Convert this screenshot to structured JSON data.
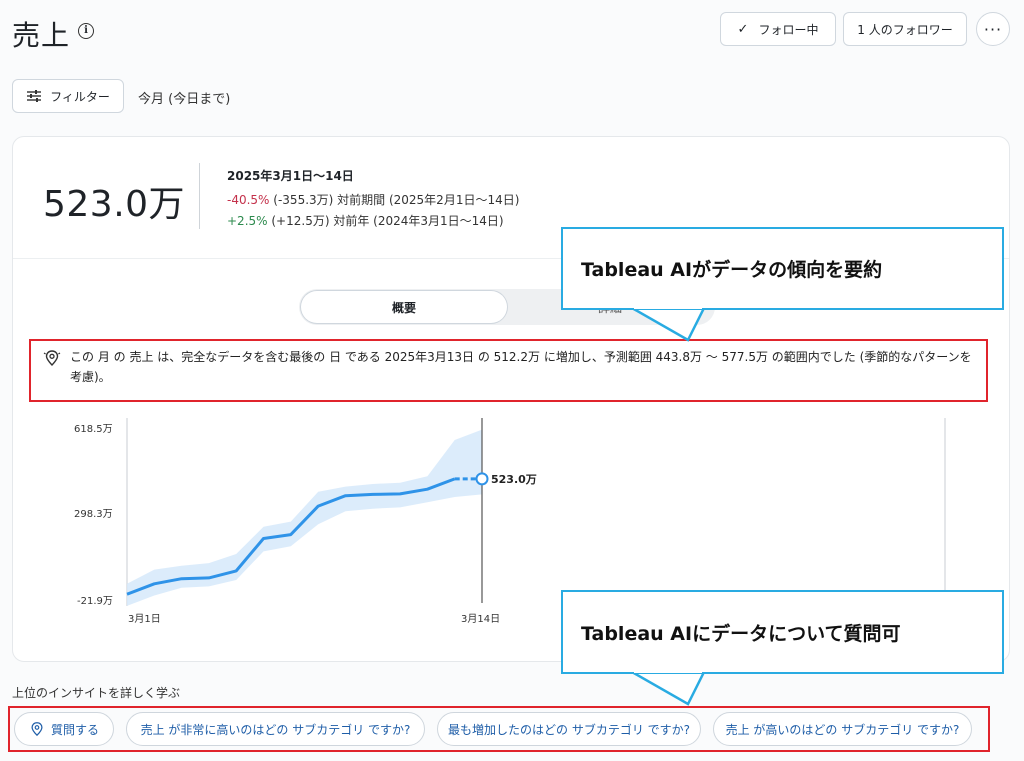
{
  "header": {
    "title": "売上",
    "follow_label": "フォロー中",
    "followers_label": "1 人のフォロワー",
    "more_label": "···"
  },
  "filter": {
    "label": "フィルター",
    "period": "今月 (今日まで)"
  },
  "metric": {
    "value": "523.0万",
    "range": "2025年3月1日～14日",
    "prev_period": {
      "change": "-40.5%",
      "detail": "(-355.3万) 対前期間 (2025年2月1日～14日)"
    },
    "prev_year": {
      "change": "+2.5%",
      "detail": "(+12.5万) 対前年 (2024年3月1日～14日)"
    }
  },
  "tabs": {
    "summary": "概要",
    "detail": "詳細"
  },
  "insight": {
    "text": "この 月 の 売上 は、完全なデータを含む最後の 日 である 2025年3月13日 の 512.2万 に増加し、予測範囲 443.8万 ～ 577.5万 の範囲内でした (季節的なパターンを考慮)。"
  },
  "chart_data": {
    "type": "line",
    "x": [
      "3月1日",
      "3月2日",
      "3月3日",
      "3月4日",
      "3月5日",
      "3月6日",
      "3月7日",
      "3月8日",
      "3月9日",
      "3月10日",
      "3月11日",
      "3月12日",
      "3月13日",
      "3月14日"
    ],
    "series": [
      {
        "values": [
          -15,
          25,
          45,
          48,
          75,
          200,
          215,
          325,
          365,
          370,
          372,
          390,
          430,
          430
        ]
      }
    ],
    "band_lower": [
      -60,
      -20,
      10,
      15,
      40,
      150,
      170,
      255,
      305,
      315,
      320,
      340,
      360,
      370
    ],
    "band_upper": [
      25,
      80,
      95,
      105,
      140,
      245,
      265,
      380,
      400,
      410,
      415,
      440,
      580,
      620
    ],
    "current_point": {
      "value": 523.0,
      "label": "523.0万"
    },
    "yticks": [
      "618.5万",
      "298.3万",
      "-21.9万"
    ],
    "ylim": [
      -21.9,
      618.5
    ],
    "xticks": [
      "3月1日",
      "3月14日"
    ],
    "colors": {
      "line": "#2f93e8",
      "band": "#d6e9fa"
    }
  },
  "questions": {
    "ask_label": "質問する",
    "q1": "売上 が非常に高いのはどの サブカテゴリ ですか?",
    "q2": "最も増加したのはどの サブカテゴリ ですか?",
    "q3": "売上 が高いのはどの サブカテゴリ ですか?"
  },
  "learn_more": "上位のインサイトを詳しく学ぶ",
  "callouts": {
    "summary": "Tableau AIがデータの傾向を要約",
    "ask": "Tableau AIにデータについて質問可"
  }
}
